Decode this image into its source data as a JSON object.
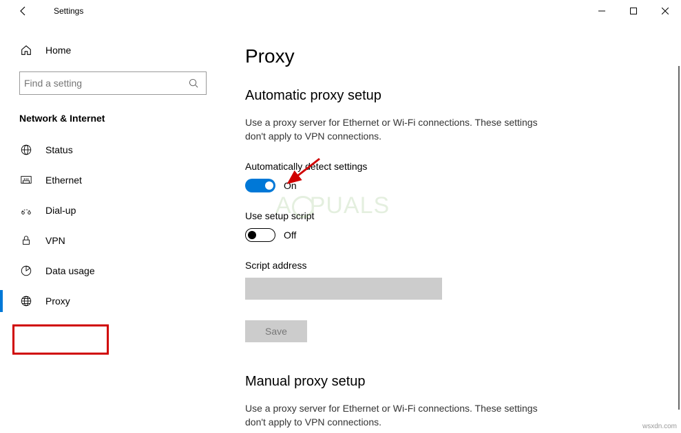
{
  "titlebar": {
    "app_name": "Settings"
  },
  "sidebar": {
    "home_label": "Home",
    "search_placeholder": "Find a setting",
    "category_label": "Network & Internet",
    "items": [
      {
        "label": "Status"
      },
      {
        "label": "Ethernet"
      },
      {
        "label": "Dial-up"
      },
      {
        "label": "VPN"
      },
      {
        "label": "Data usage"
      },
      {
        "label": "Proxy"
      }
    ]
  },
  "content": {
    "page_title": "Proxy",
    "auto_section_title": "Automatic proxy setup",
    "auto_section_desc": "Use a proxy server for Ethernet or Wi-Fi connections. These settings don't apply to VPN connections.",
    "auto_detect_label": "Automatically detect settings",
    "auto_detect_state": "On",
    "setup_script_label": "Use setup script",
    "setup_script_state": "Off",
    "script_address_label": "Script address",
    "save_label": "Save",
    "manual_section_title": "Manual proxy setup",
    "manual_section_desc": "Use a proxy server for Ethernet or Wi-Fi connections. These settings don't apply to VPN connections."
  },
  "watermark_site": "wsxdn.com"
}
